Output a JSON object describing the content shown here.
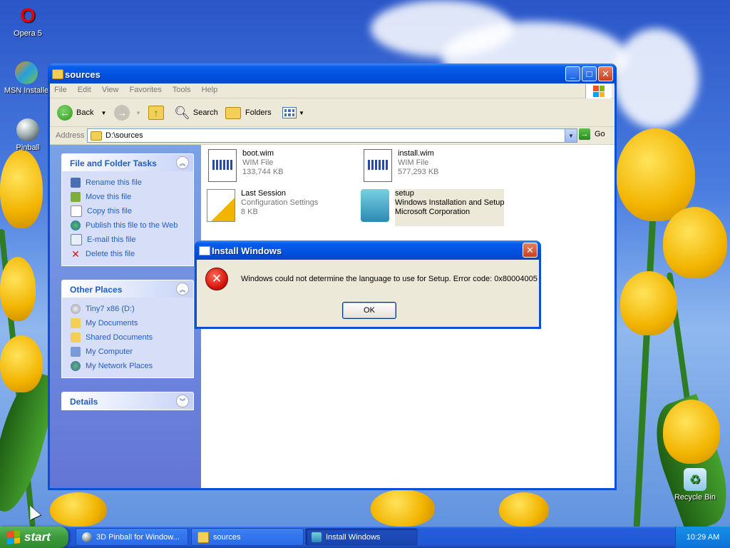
{
  "desktop": {
    "icons": [
      {
        "label": "Opera 5"
      },
      {
        "label": "MSN Installe"
      },
      {
        "label": "Pinball"
      },
      {
        "label": "Recycle Bin"
      }
    ]
  },
  "window": {
    "title": "sources",
    "menu": [
      "File",
      "Edit",
      "View",
      "Favorites",
      "Tools",
      "Help"
    ],
    "toolbar": {
      "back": "Back",
      "search": "Search",
      "folders": "Folders"
    },
    "address": {
      "label": "Address",
      "value": "D:\\sources",
      "go": "Go"
    }
  },
  "tasks": {
    "file_folder": {
      "title": "File and Folder Tasks",
      "items": [
        "Rename this file",
        "Move this file",
        "Copy this file",
        "Publish this file to the Web",
        "E-mail this file",
        "Delete this file"
      ]
    },
    "other_places": {
      "title": "Other Places",
      "items": [
        "Tiny7 x86 (D:)",
        "My Documents",
        "Shared Documents",
        "My Computer",
        "My Network Places"
      ]
    },
    "details": {
      "title": "Details"
    }
  },
  "files": [
    {
      "name": "boot.wim",
      "type": "WIM File",
      "size": "133,744 KB"
    },
    {
      "name": "install.wim",
      "type": "WIM File",
      "size": "577,293 KB"
    },
    {
      "name": "Last Session",
      "type": "Configuration Settings",
      "size": "8 KB"
    },
    {
      "name": "setup",
      "type": "Windows Installation and Setup",
      "size": "Microsoft Corporation"
    }
  ],
  "dialog": {
    "title": "Install Windows",
    "message": "Windows could not determine the language to use for Setup. Error code: 0x80004005",
    "ok": "OK"
  },
  "taskbar": {
    "start": "start",
    "tasks": [
      "3D Pinball for Window...",
      "sources",
      "Install Windows"
    ],
    "clock": "10:29 AM"
  },
  "colors": {
    "xp_blue": "#0a4fd8",
    "task_link": "#215dc6",
    "error_red": "#d2140a"
  }
}
